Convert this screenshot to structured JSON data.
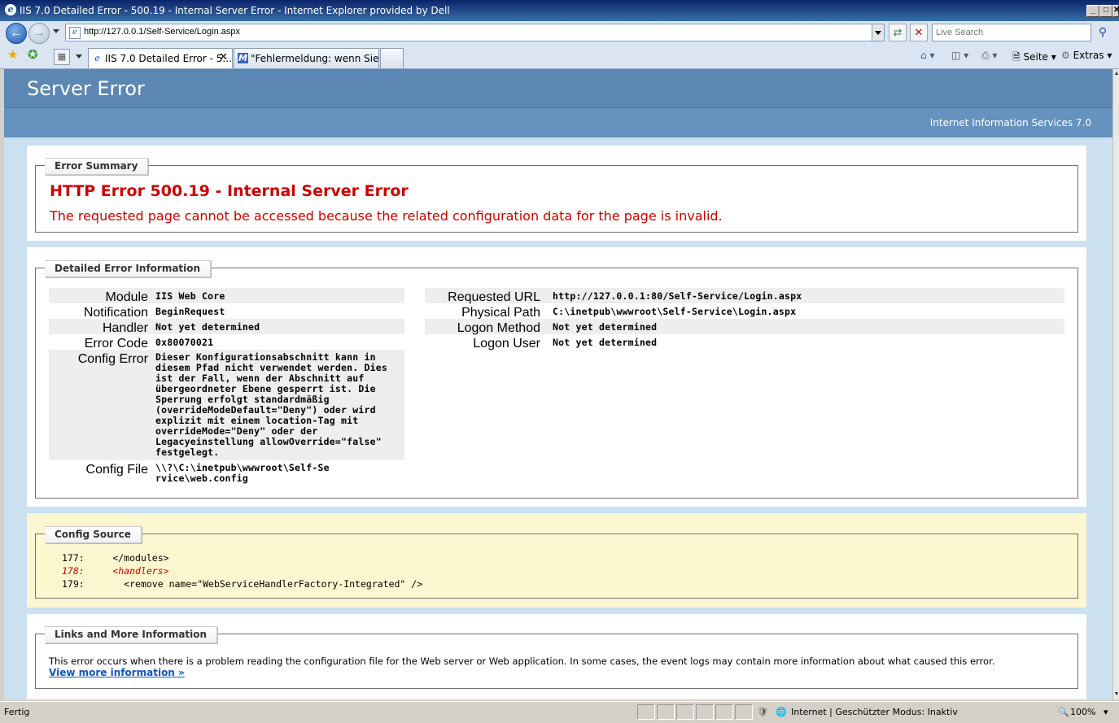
{
  "window": {
    "title": "IIS 7.0 Detailed Error - 500.19 - Internal Server Error - Internet Explorer provided by Dell",
    "buttons": {
      "minimize": "_",
      "maximize": "□",
      "close": "✕"
    }
  },
  "address": {
    "url": "http://127.0.0.1/Self-Service/Login.aspx",
    "search_placeholder": "Live Search"
  },
  "tabs": [
    {
      "label": "IIS 7.0 Detailed Error - 5...",
      "active": true
    },
    {
      "label": "\"Fehlermeldung: wenn Sie ei...",
      "active": false
    }
  ],
  "commandbar": {
    "page": "Seite",
    "tools": "Extras"
  },
  "page": {
    "heading": "Server Error",
    "product": "Internet Information Services 7.0",
    "summary": {
      "legend": "Error Summary",
      "title": "HTTP Error 500.19 - Internal Server Error",
      "subtitle": "The requested page cannot be accessed because the related configuration data for the page is invalid."
    },
    "details": {
      "legend": "Detailed Error Information",
      "left": [
        {
          "key": "Module",
          "value": "IIS Web Core"
        },
        {
          "key": "Notification",
          "value": "BeginRequest"
        },
        {
          "key": "Handler",
          "value": "Not yet determined"
        },
        {
          "key": "Error Code",
          "value": "0x80070021"
        },
        {
          "key": "Config Error",
          "value": "Dieser Konfigurationsabschnitt kann in diesem Pfad nicht verwendet werden. Dies ist der Fall, wenn der Abschnitt auf übergeordneter Ebene gesperrt ist. Die Sperrung erfolgt standardmäßig (overrideModeDefault=\"Deny\") oder wird explizit mit einem location-Tag mit overrideMode=\"Deny\" oder der Legacyeinstellung allowOverride=\"false\" festgelegt."
        },
        {
          "key": "Config File",
          "value": "\\\\?\\C:\\inetpub\\wwwroot\\Self-Service\\web.config"
        }
      ],
      "right": [
        {
          "key": "Requested URL",
          "value": "http://127.0.0.1:80/Self-Service/Login.aspx"
        },
        {
          "key": "Physical Path",
          "value": "C:\\inetpub\\wwwroot\\Self-Service\\Login.aspx"
        },
        {
          "key": "Logon Method",
          "value": "Not yet determined"
        },
        {
          "key": "Logon User",
          "value": "Not yet determined"
        }
      ]
    },
    "config_source": {
      "legend": "Config Source",
      "lines": [
        {
          "num": "177:",
          "code": "</modules>"
        },
        {
          "num": "178:",
          "code": "<handlers>"
        },
        {
          "num": "179:",
          "code": "  <remove name=\"WebServiceHandlerFactory-Integrated\" />"
        }
      ]
    },
    "links": {
      "legend": "Links and More Information",
      "text": "This error occurs when there is a problem reading the configuration file for the Web server or Web application. In some cases, the event logs may contain more information about what caused this error.",
      "more": "View more information »"
    }
  },
  "status": {
    "left": "Fertig",
    "zone": "Internet | Geschützter Modus: Inaktiv",
    "zoom": "100%"
  }
}
